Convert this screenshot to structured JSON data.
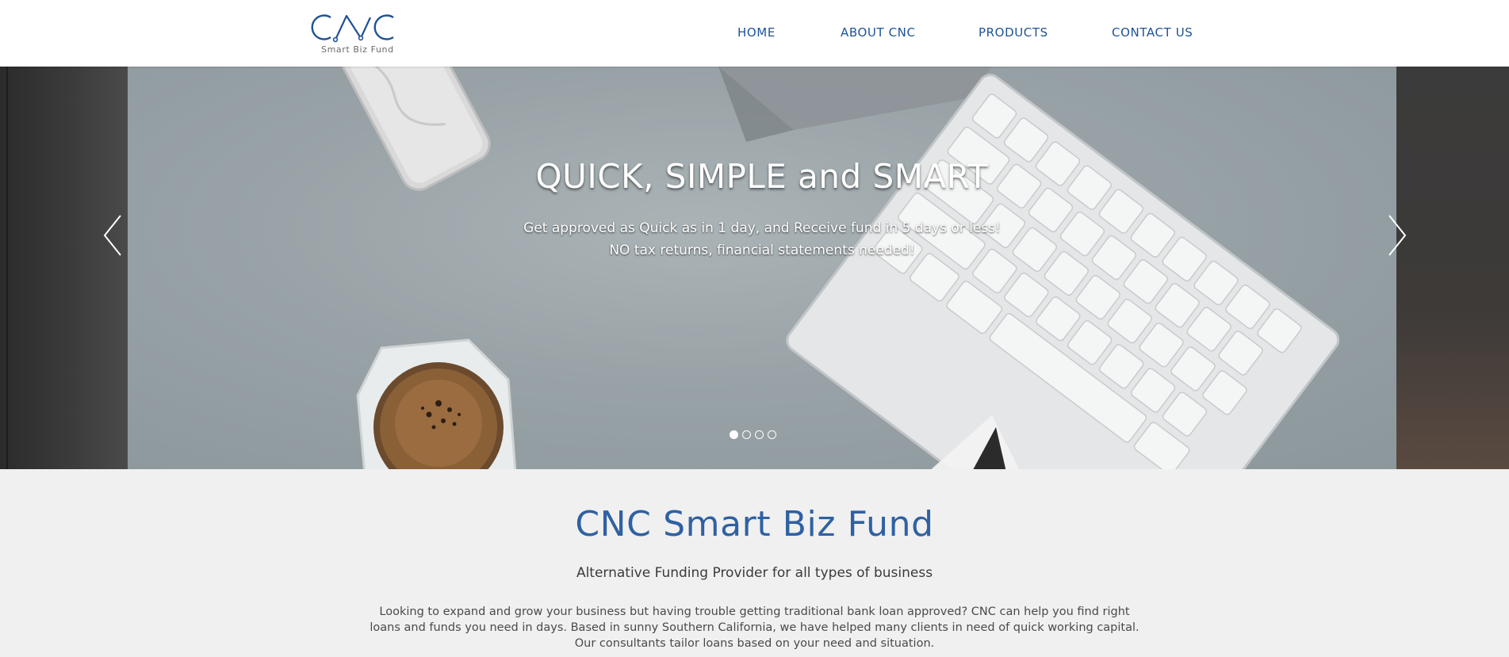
{
  "header": {
    "logo": {
      "mark": "CNC",
      "tagline": "Smart Biz Fund",
      "icon": "cnc-logo-icon"
    },
    "nav": [
      {
        "label": "HOME"
      },
      {
        "label": "ABOUT CNC"
      },
      {
        "label": "PRODUCTS"
      },
      {
        "label": "CONTACT US"
      }
    ]
  },
  "hero": {
    "title": "QUICK, SIMPLE and SMART",
    "subtitle_lines": [
      "Get approved as Quick as in 1 day, and Receive fund in 5 days or less!",
      "NO tax returns, financial statements needed!"
    ],
    "prev_icon": "chevron-left-icon",
    "next_icon": "chevron-right-icon",
    "slides": {
      "count": 4,
      "active_index": 0
    }
  },
  "intro": {
    "title": "CNC Smart Biz Fund",
    "subtitle": "Alternative Funding Provider for all types of business",
    "body_lines": [
      "Looking to expand and grow your business but having trouble getting traditional bank loan approved? CNC can help you find right",
      "loans and funds you need in days. Based in sunny Southern California, we have helped many clients in need of quick working capital.",
      "Our consultants tailor loans based on your need and situation."
    ]
  },
  "colors": {
    "brand_blue": "#1f5296",
    "heading_blue": "#2f61a2",
    "header_bg": "#ffffff",
    "page_bg": "#f0f0f0"
  }
}
